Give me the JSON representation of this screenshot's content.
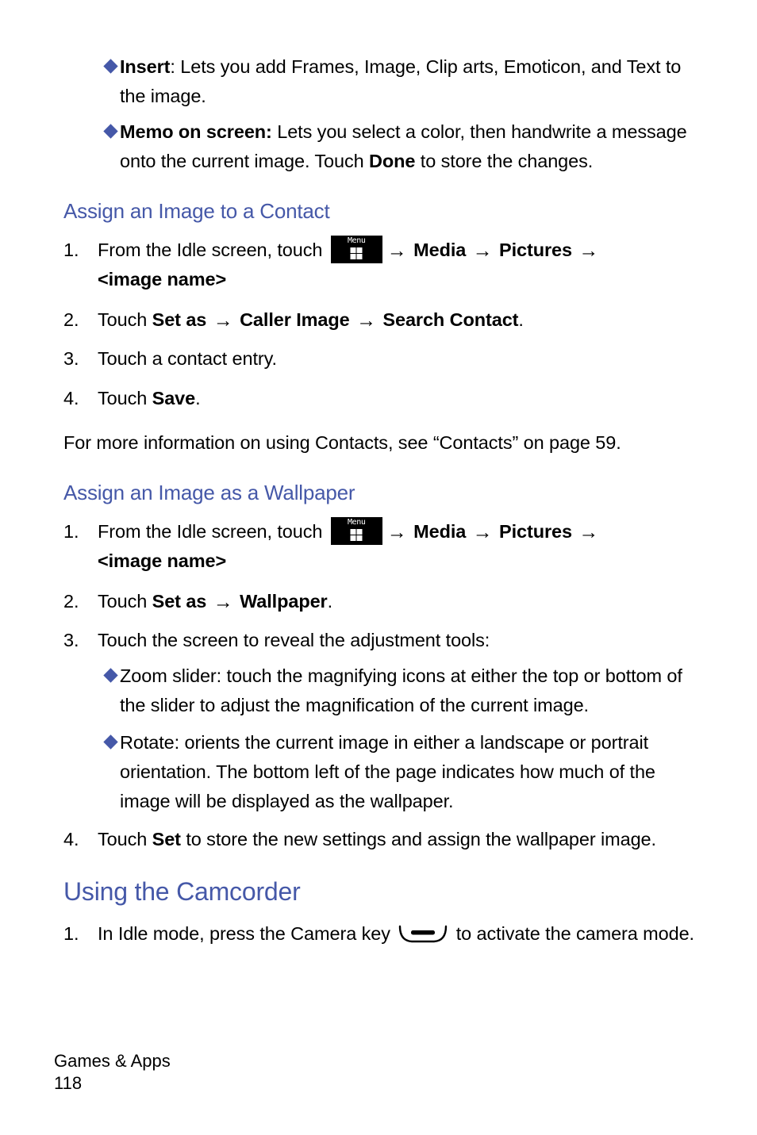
{
  "page": {
    "footer_section": "Games & Apps",
    "footer_page_number": "118",
    "accent_color": "#4558a8",
    "text_color": "#000000",
    "background_color": "#ffffff"
  },
  "bullets_top": [
    {
      "icon": "diamond-bullet",
      "lead": "Insert",
      "lead_punct": ": ",
      "text": "Lets you add Frames, Image, Clip arts, Emoticon, and Text to the image."
    },
    {
      "icon": "diamond-bullet",
      "lead": "Memo on screen:",
      "lead_punct": " ",
      "text_before_bold": "Lets you select a color, then handwrite a message onto the current image. Touch ",
      "inline_bold": "Done",
      "text_after_bold": " to store the changes."
    }
  ],
  "section_contact": {
    "heading": "Assign an Image to a Contact",
    "steps": [
      {
        "number": "1.",
        "part1": "From the Idle screen, touch ",
        "menu_icon_label": "Menu",
        "arrow": "→",
        "crumb1": "Media",
        "crumb2": "Pictures",
        "crumb3": "<image name>"
      },
      {
        "number": "2.",
        "part1": "Touch ",
        "b1": "Set as",
        "arrow": "→",
        "b2": "Caller Image",
        "b3": "Search Contact",
        "tail": "."
      },
      {
        "number": "3.",
        "text": "Touch a contact entry."
      },
      {
        "number": "4.",
        "part1": "Touch ",
        "b1": "Save",
        "tail": "."
      }
    ],
    "note": "For more information on using Contacts, see “Contacts” on page 59."
  },
  "section_wallpaper": {
    "heading": "Assign an Image as a Wallpaper",
    "steps": [
      {
        "number": "1.",
        "part1": "From the Idle screen, touch ",
        "menu_icon_label": "Menu",
        "arrow": "→",
        "crumb1": "Media",
        "crumb2": "Pictures",
        "crumb3": "<image name>"
      },
      {
        "number": "2.",
        "part1": "Touch ",
        "b1": "Set as",
        "arrow": "→",
        "b2": "Wallpaper",
        "tail": "."
      },
      {
        "number": "3.",
        "text": "Touch the screen to reveal the adjustment tools:"
      },
      {
        "number": "4.",
        "part1": "Touch ",
        "b1": "Set",
        "tail": " to store the new settings and assign the wallpaper image."
      }
    ],
    "sub_bullets": [
      {
        "icon": "diamond-bullet",
        "text": "Zoom slider: touch the magnifying icons at either the top or bottom of the slider to adjust the magnification of the current image."
      },
      {
        "icon": "diamond-bullet",
        "text": "Rotate: orients the current image in either a landscape or portrait orientation. The bottom left of the page indicates how much of the image will be displayed as the wallpaper."
      }
    ]
  },
  "section_camcorder": {
    "heading": "Using the Camcorder",
    "steps": [
      {
        "number": "1.",
        "part1": "In Idle mode, press the Camera key ",
        "camera_icon_label": "camera-key",
        "part2": " to activate the camera mode."
      }
    ]
  }
}
